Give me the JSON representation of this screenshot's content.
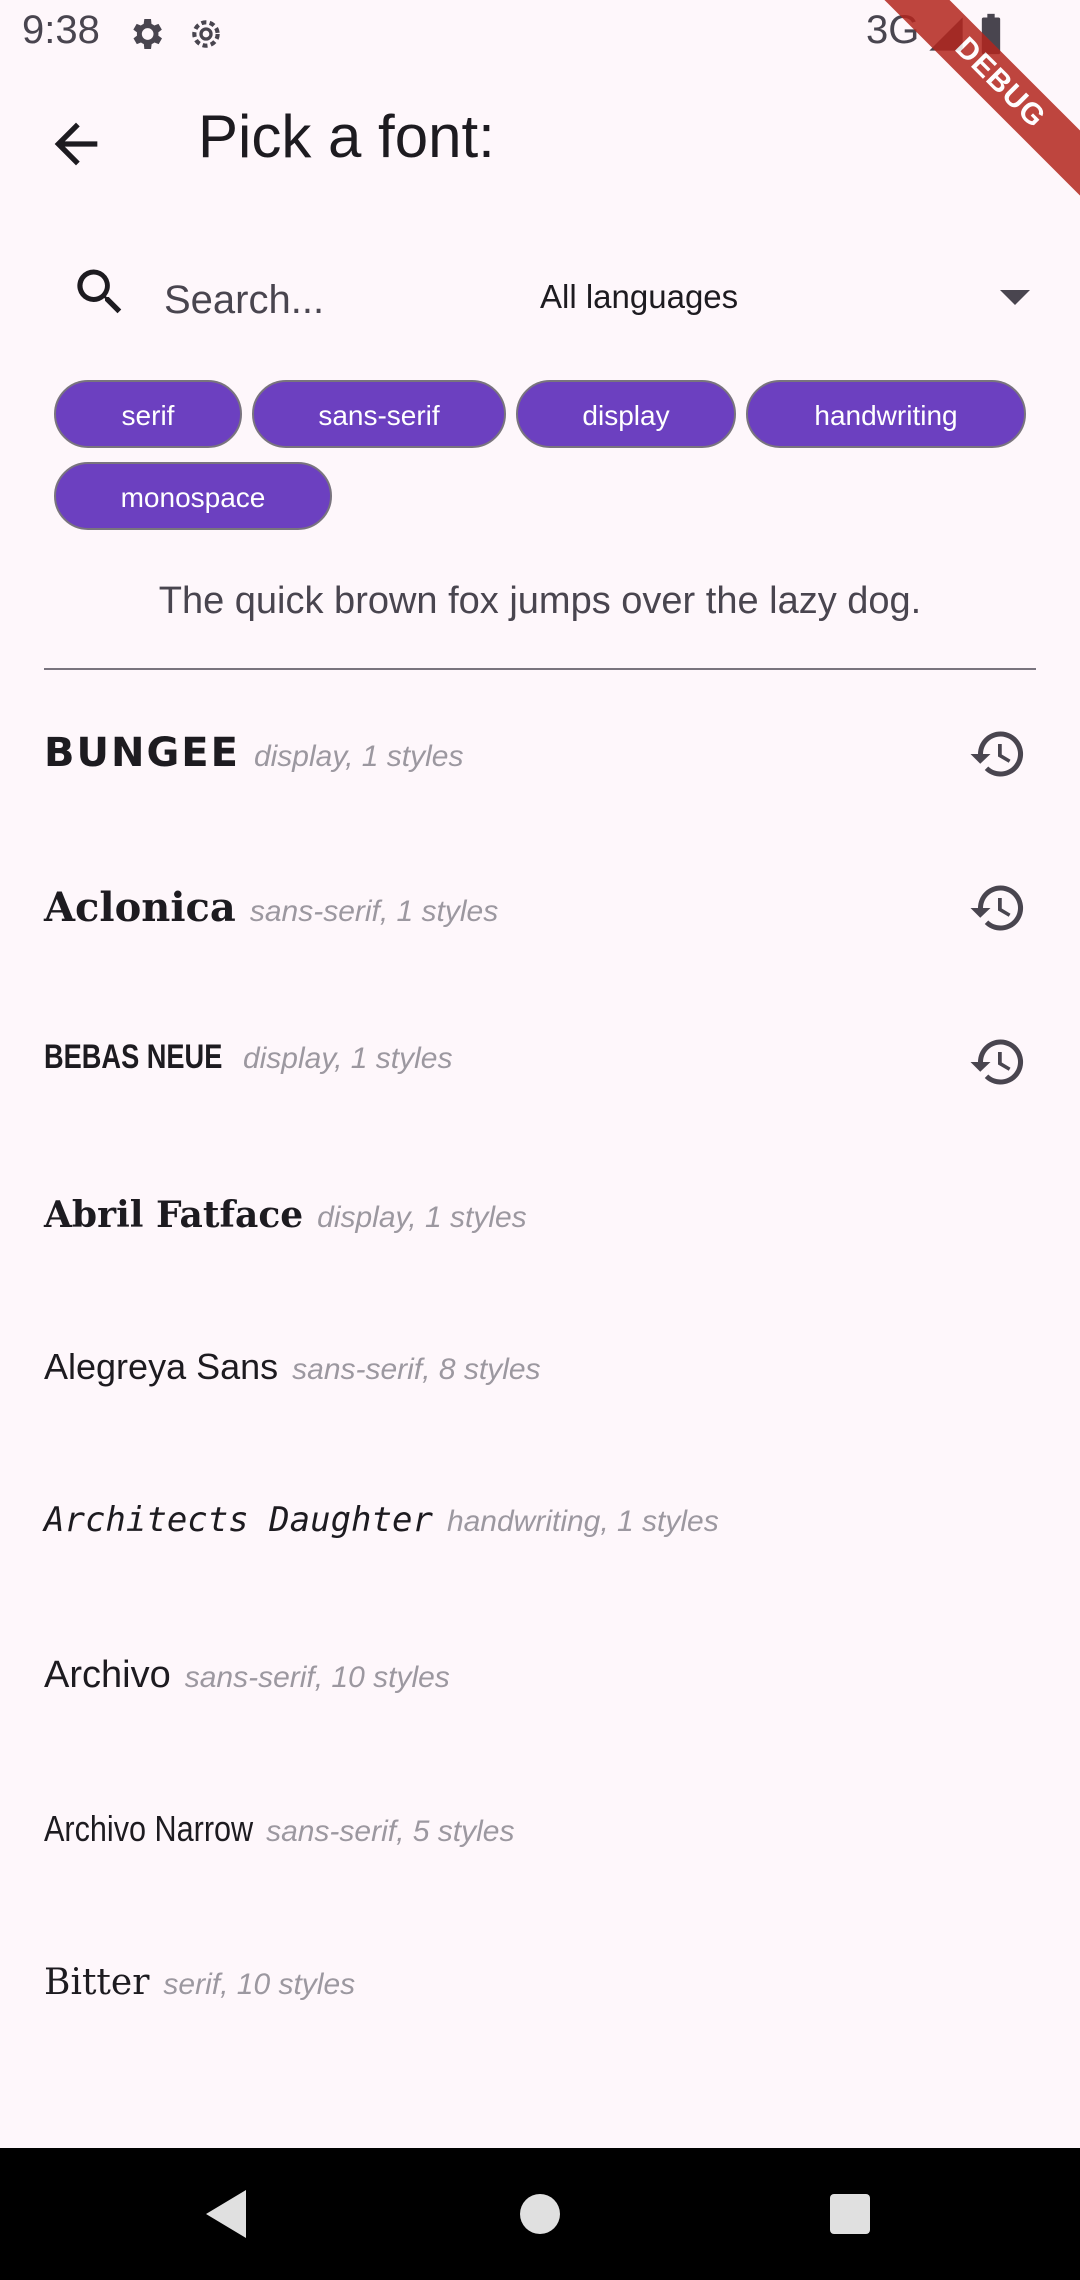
{
  "status_bar": {
    "time": "9:38",
    "network": "3G",
    "debug_label": "DEBUG"
  },
  "app_bar": {
    "title": "Pick a font:"
  },
  "search": {
    "placeholder": "Search...",
    "language_selected": "All languages"
  },
  "chips": [
    {
      "label": "serif"
    },
    {
      "label": "sans-serif"
    },
    {
      "label": "display"
    },
    {
      "label": "handwriting"
    },
    {
      "label": "monospace"
    }
  ],
  "preview_text": "The quick brown fox jumps over the lazy dog.",
  "fonts": [
    {
      "name": "BUNGEE",
      "meta": "display, 1 styles",
      "recent": true
    },
    {
      "name": "Aclonica",
      "meta": "sans-serif, 1 styles",
      "recent": true
    },
    {
      "name": "BEBAS NEUE",
      "meta": "display, 1 styles",
      "recent": true
    },
    {
      "name": "Abril Fatface",
      "meta": "display, 1 styles",
      "recent": false
    },
    {
      "name": "Alegreya Sans",
      "meta": "sans-serif, 8 styles",
      "recent": false
    },
    {
      "name": "Architects Daughter",
      "meta": "handwriting, 1 styles",
      "recent": false
    },
    {
      "name": "Archivo",
      "meta": "sans-serif, 10 styles",
      "recent": false
    },
    {
      "name": "Archivo Narrow",
      "meta": "sans-serif, 5 styles",
      "recent": false
    },
    {
      "name": "Bitter",
      "meta": "serif, 10 styles",
      "recent": false
    }
  ],
  "colors": {
    "chip": "#6c40c0",
    "background": "#fef7fb",
    "debug": "#b3261e"
  },
  "icons": {
    "back": "arrow-back-icon",
    "search": "search-icon",
    "history": "history-icon",
    "settings": "gear-icon"
  }
}
